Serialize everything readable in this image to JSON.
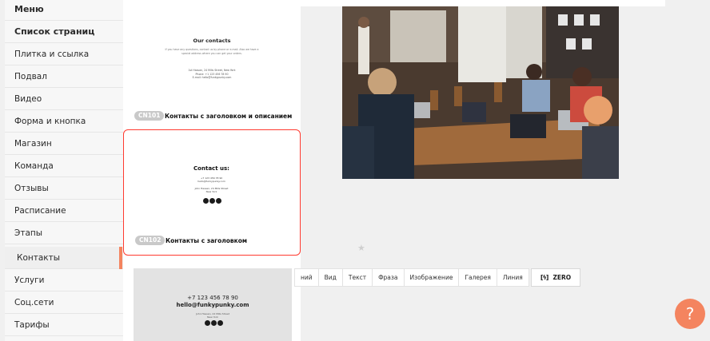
{
  "sidebar": {
    "items": [
      {
        "label": "Меню"
      },
      {
        "label": "Список страниц"
      },
      {
        "label": "Плитка и ссылка"
      },
      {
        "label": "Подвал"
      },
      {
        "label": "Видео"
      },
      {
        "label": "Форма и кнопка"
      },
      {
        "label": "Магазин"
      },
      {
        "label": "Команда"
      },
      {
        "label": "Отзывы"
      },
      {
        "label": "Расписание"
      },
      {
        "label": "Этапы"
      },
      {
        "label": "Контакты"
      },
      {
        "label": "Услуги"
      },
      {
        "label": "Соц.сети"
      },
      {
        "label": "Тарифы"
      }
    ],
    "active_label": "Контакты"
  },
  "templates": {
    "cn101": {
      "preview_title": "Our contacts",
      "preview_desc": "If you have any questions, contact us by phone or e-mail. Also we have a special address where you can get your orders.",
      "preview_contact": "1st Hassan, 24 Mills Street, New York\nPhone: +1 123 456 78 90\nE-mail: hello@funkypunky.com",
      "code": "CN101",
      "label": "Контакты с заголовком и описанием"
    },
    "cn102": {
      "preview_title": "Contact us:",
      "preview_lines": "+7 123 456 78 90\nhello@funkypunky.com\n\nJohn Hassan, 24 Mills Street\nNew York",
      "code": "CN102",
      "label": "Контакты с заголовком"
    },
    "cn103": {
      "phone": "+7 123 456 78 90",
      "email": "hello@funkypunky.com",
      "address": "John Hassan, 24 Mills Street\nNew York"
    }
  },
  "toolbar": {
    "items": [
      "ний",
      "Вид",
      "Текст",
      "Фраза",
      "Изображение",
      "Галерея",
      "Линия"
    ],
    "zero_label": "ZERO",
    "zero_icon": "[ϟ]"
  },
  "help": {
    "label": "?"
  },
  "colors": {
    "accent": "#f4845f",
    "selected_border": "#ff3b30"
  }
}
